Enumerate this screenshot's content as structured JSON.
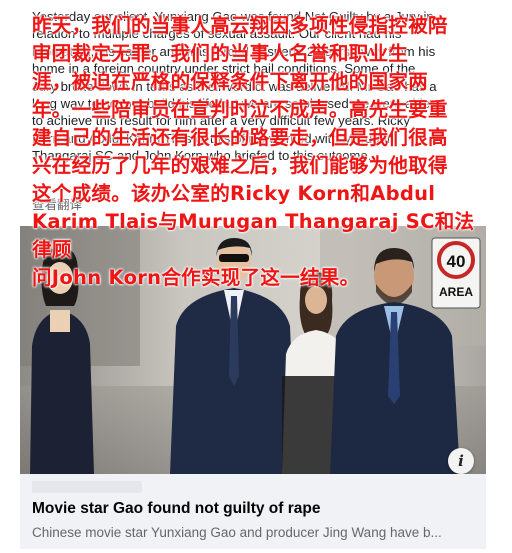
{
  "post": {
    "body_lines": [
      "Yesterday our client, Yunxiang Gao was found Not Guilty by a Jury in",
      "relation to multiple charges of sexual assault. Our client had his",
      "reputation, his career and was forced to spend 2 years away from his",
      "home in a foreign country under strict bail conditions. Some of the",
      "Jury broke down in tears as their verdict was delivered. Mr Gao has a",
      "long way to go to rebuild his life but we are so pleased we were able",
      "to achieve this result for him after a very difficult few years. Ricky",
      "Korn and Abdul Karim Tlais of this office worked with Murugan",
      "Thangaraj SC and John Korn who briefed to this outcome."
    ],
    "see_translation": "查看翻译",
    "overlay_lines": [
      "昨天，我们的当事人高云翔因多项性侵指控被陪",
      "审团裁定无罪。我们的当事人名誉和职业生",
      "涯，被迫在严格的保释条件下离开他的国家两",
      "年。一些陪审员在宣判时泣不成声。高先生要重",
      "建自己的生活还有很长的路要走，但是我们很高",
      "兴在经历了几年的艰难之后，我们能够为他取得",
      "这个成绩。该办公室的Ricky Korn和Abdul",
      "Karim Tlais与Murugan Thangaraj SC和法律顾",
      "问John Korn合作实现了这一结果。"
    ]
  },
  "link_card": {
    "title": "Movie star Gao found not guilty of rape",
    "description": "Chinese movie star Yunxiang Gao and producer Jing Wang have b..."
  },
  "photo": {
    "sign_text": "40",
    "sign_subtext": "AREA",
    "info_label": "i"
  },
  "colors": {
    "overlay_text": "#ee1515",
    "link_card_bg": "#f0f2f5"
  }
}
